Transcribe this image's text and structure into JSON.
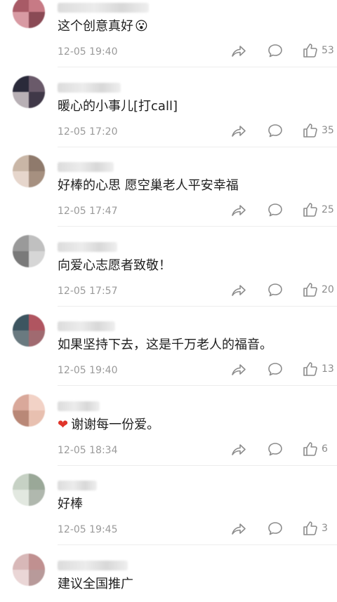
{
  "comments": [
    {
      "text": "这个创意真好",
      "emoji": "😮",
      "time": "12-05 19:40",
      "likes": "53",
      "avatar_colors": [
        "#a85a66",
        "#c77a85",
        "#d89aa3",
        "#8a4a55"
      ],
      "name_width": 130
    },
    {
      "text": "暖心的小事儿[打call]",
      "time": "12-05 17:20",
      "likes": "35",
      "avatar_colors": [
        "#2a2a3a",
        "#6a5a6a",
        "#b8b0b5",
        "#403848"
      ],
      "name_width": 90
    },
    {
      "text": "好棒的心思 愿空巢老人平安幸福",
      "time": "12-05 17:47",
      "likes": "25",
      "avatar_colors": [
        "#c9b6a6",
        "#8f7a6c",
        "#e6d6cc",
        "#a69080"
      ],
      "name_width": 80
    },
    {
      "text": "向爱心志愿者致敬！",
      "time": "12-05 17:57",
      "likes": "20",
      "avatar_colors": [
        "#9a9a9a",
        "#c0c0c0",
        "#7a7a7a",
        "#d6d6d6"
      ],
      "name_width": 85
    },
    {
      "text": "如果坚持下去，这是千万老人的福音。",
      "time": "12-05 19:40",
      "likes": "13",
      "avatar_colors": [
        "#3d5560",
        "#b05560",
        "#6a7a80",
        "#a06a70"
      ],
      "name_width": 82
    },
    {
      "text": "谢谢每一份爱。",
      "heart": "❤",
      "time": "12-05 18:34",
      "likes": "6",
      "avatar_colors": [
        "#d9a89a",
        "#f2d2c6",
        "#b98877",
        "#e8c0b0"
      ],
      "name_width": 60
    },
    {
      "text": "好棒",
      "time": "12-05 19:45",
      "likes": "3",
      "avatar_colors": [
        "#c6d1c4",
        "#9aa898",
        "#e2e8e0",
        "#b0b8ae"
      ],
      "name_width": 56
    },
    {
      "text": "建议全国推广",
      "time": "",
      "likes": "",
      "avatar_colors": [
        "#d8b8b8",
        "#c09090",
        "#ead6d6",
        "#b89a9a"
      ],
      "name_width": 100
    }
  ]
}
